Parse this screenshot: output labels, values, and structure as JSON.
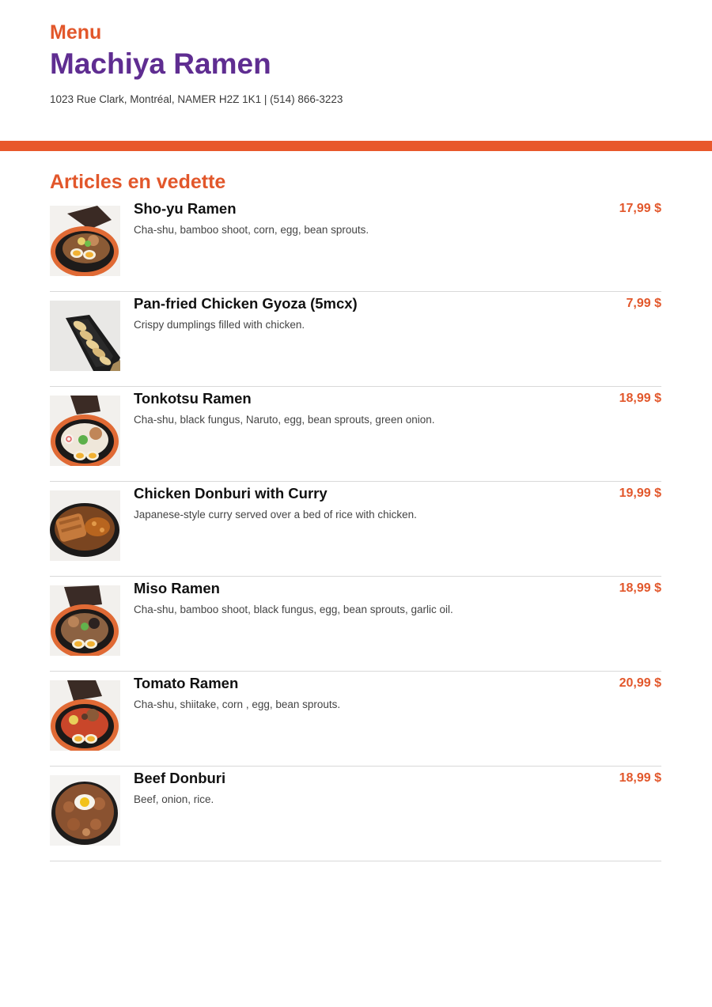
{
  "header": {
    "menu_label": "Menu",
    "restaurant_name": "Machiya Ramen",
    "address": "1023 Rue Clark, Montréal, NAMER H2Z 1K1 | (514) 866-3223"
  },
  "colors": {
    "accent": "#e8582b",
    "brand": "#5f2d91"
  },
  "section": {
    "title": "Articles en vedette"
  },
  "items": [
    {
      "name": "Sho-yu Ramen",
      "description": "Cha-shu, bamboo shoot, corn, egg, bean sprouts.",
      "price": "17,99 $",
      "image_icon": "shoyu-ramen-photo"
    },
    {
      "name": "Pan-fried Chicken Gyoza (5mcx)",
      "description": "Crispy dumplings filled with chicken.",
      "price": "7,99 $",
      "image_icon": "gyoza-photo"
    },
    {
      "name": "Tonkotsu Ramen",
      "description": "Cha-shu, black fungus, Naruto, egg, bean sprouts, green onion.",
      "price": "18,99 $",
      "image_icon": "tonkotsu-ramen-photo"
    },
    {
      "name": "Chicken Donburi with Curry",
      "description": "Japanese-style curry served over a bed of rice with chicken.",
      "price": "19,99 $",
      "image_icon": "curry-donburi-photo"
    },
    {
      "name": "Miso Ramen",
      "description": "Cha-shu, bamboo shoot, black fungus, egg, bean sprouts, garlic oil.",
      "price": "18,99 $",
      "image_icon": "miso-ramen-photo"
    },
    {
      "name": "Tomato Ramen",
      "description": "Cha-shu, shiitake, corn , egg, bean sprouts.",
      "price": "20,99 $",
      "image_icon": "tomato-ramen-photo"
    },
    {
      "name": "Beef Donburi",
      "description": "Beef, onion, rice.",
      "price": "18,99 $",
      "image_icon": "beef-donburi-photo"
    }
  ]
}
